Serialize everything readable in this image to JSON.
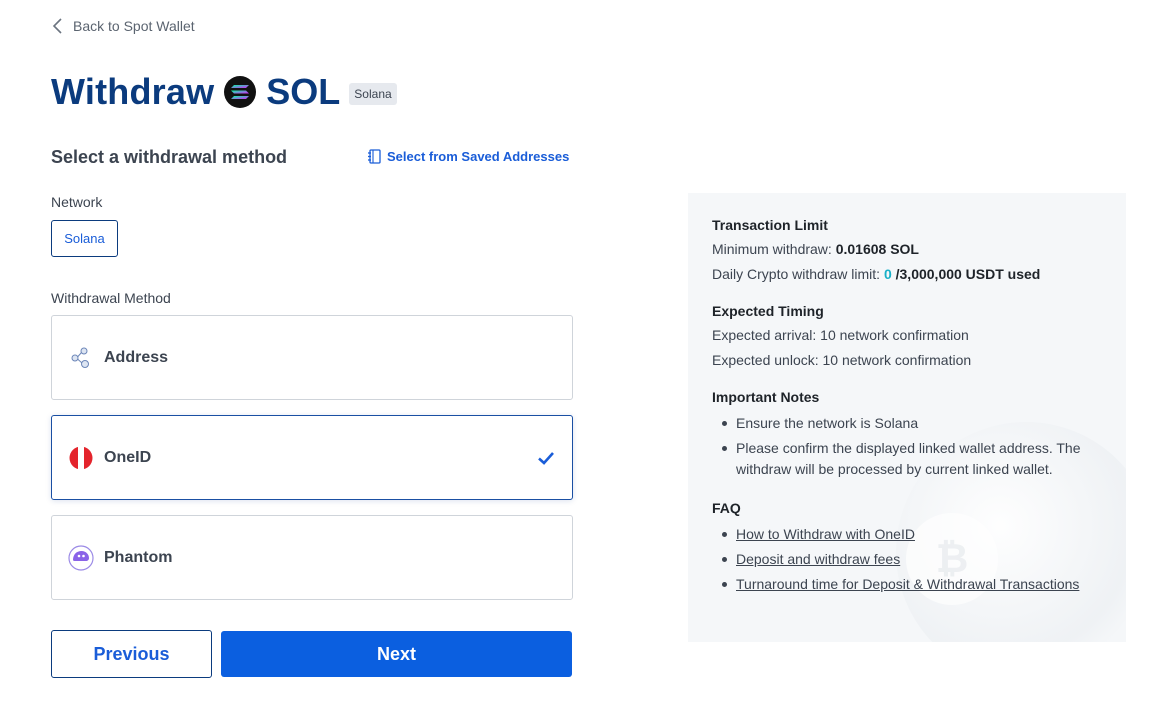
{
  "nav": {
    "back_label": "Back to Spot Wallet"
  },
  "header": {
    "title_prefix": "Withdraw",
    "coin_symbol": "SOL",
    "network_badge": "Solana"
  },
  "method_section": {
    "title": "Select a withdrawal method",
    "saved_addresses_label": "Select from Saved Addresses"
  },
  "network": {
    "label": "Network",
    "selected": "Solana"
  },
  "withdrawal_method": {
    "label": "Withdrawal Method",
    "options": [
      {
        "label": "Address",
        "icon": "address-icon",
        "selected": false
      },
      {
        "label": "OneID",
        "icon": "oneid-icon",
        "selected": true
      },
      {
        "label": "Phantom",
        "icon": "phantom-icon",
        "selected": false
      }
    ]
  },
  "buttons": {
    "previous": "Previous",
    "next": "Next"
  },
  "info_panel": {
    "transaction_limit": {
      "title": "Transaction Limit",
      "min_withdraw_label": "Minimum withdraw:",
      "min_withdraw_value": "0.01608 SOL",
      "daily_limit_label": "Daily Crypto withdraw limit:",
      "daily_limit_used": "0",
      "daily_limit_total": "/3,000,000 USDT used"
    },
    "expected_timing": {
      "title": "Expected Timing",
      "arrival": "Expected arrival: 10 network confirmation",
      "unlock": "Expected unlock: 10 network confirmation"
    },
    "important_notes": {
      "title": "Important Notes",
      "items": [
        "Ensure the network is Solana",
        "Please confirm the displayed linked wallet address. The withdraw will be processed by current linked wallet."
      ]
    },
    "faq": {
      "title": "FAQ",
      "links": [
        "How to Withdraw with OneID",
        "Deposit and withdraw fees",
        "Turnaround time for Deposit & Withdrawal Transactions"
      ]
    }
  },
  "colors": {
    "brand_navy": "#0b3b7e",
    "primary_blue": "#0b5fe0",
    "link_blue": "#1a5dd8",
    "highlight_cyan": "#18b0c8",
    "panel_bg": "#f5f7f9"
  }
}
